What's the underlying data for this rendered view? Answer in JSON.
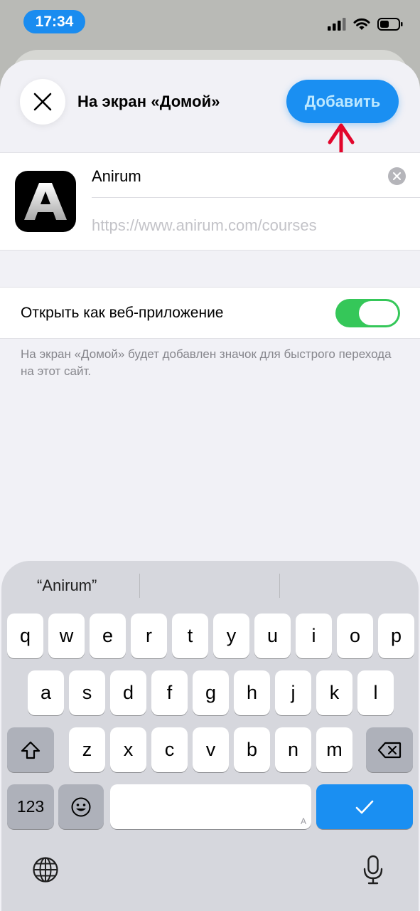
{
  "status_bar": {
    "time": "17:34"
  },
  "sheet": {
    "title": "На экран «Домой»",
    "add_button_label": "Добавить",
    "close_icon": "close-icon"
  },
  "app": {
    "icon_letter": "A",
    "name": "Anirum",
    "url": "https://www.anirum.com/courses"
  },
  "web_app_toggle": {
    "label": "Открыть как веб-приложение",
    "on": true
  },
  "footnote": "На экран «Домой» будет добавлен значок для быстрого перехода на этот сайт.",
  "keyboard": {
    "suggestion": "“Anirum”",
    "row1": [
      "q",
      "w",
      "e",
      "r",
      "t",
      "y",
      "u",
      "i",
      "o",
      "p"
    ],
    "row2": [
      "a",
      "s",
      "d",
      "f",
      "g",
      "h",
      "j",
      "k",
      "l"
    ],
    "row3": [
      "z",
      "x",
      "c",
      "v",
      "b",
      "n",
      "m"
    ],
    "numbers_key": "123",
    "space_mark": "A",
    "colors": {
      "done_key": "#1a8ff2",
      "toggle_on": "#35c759",
      "arrow": "#e2062c"
    }
  }
}
